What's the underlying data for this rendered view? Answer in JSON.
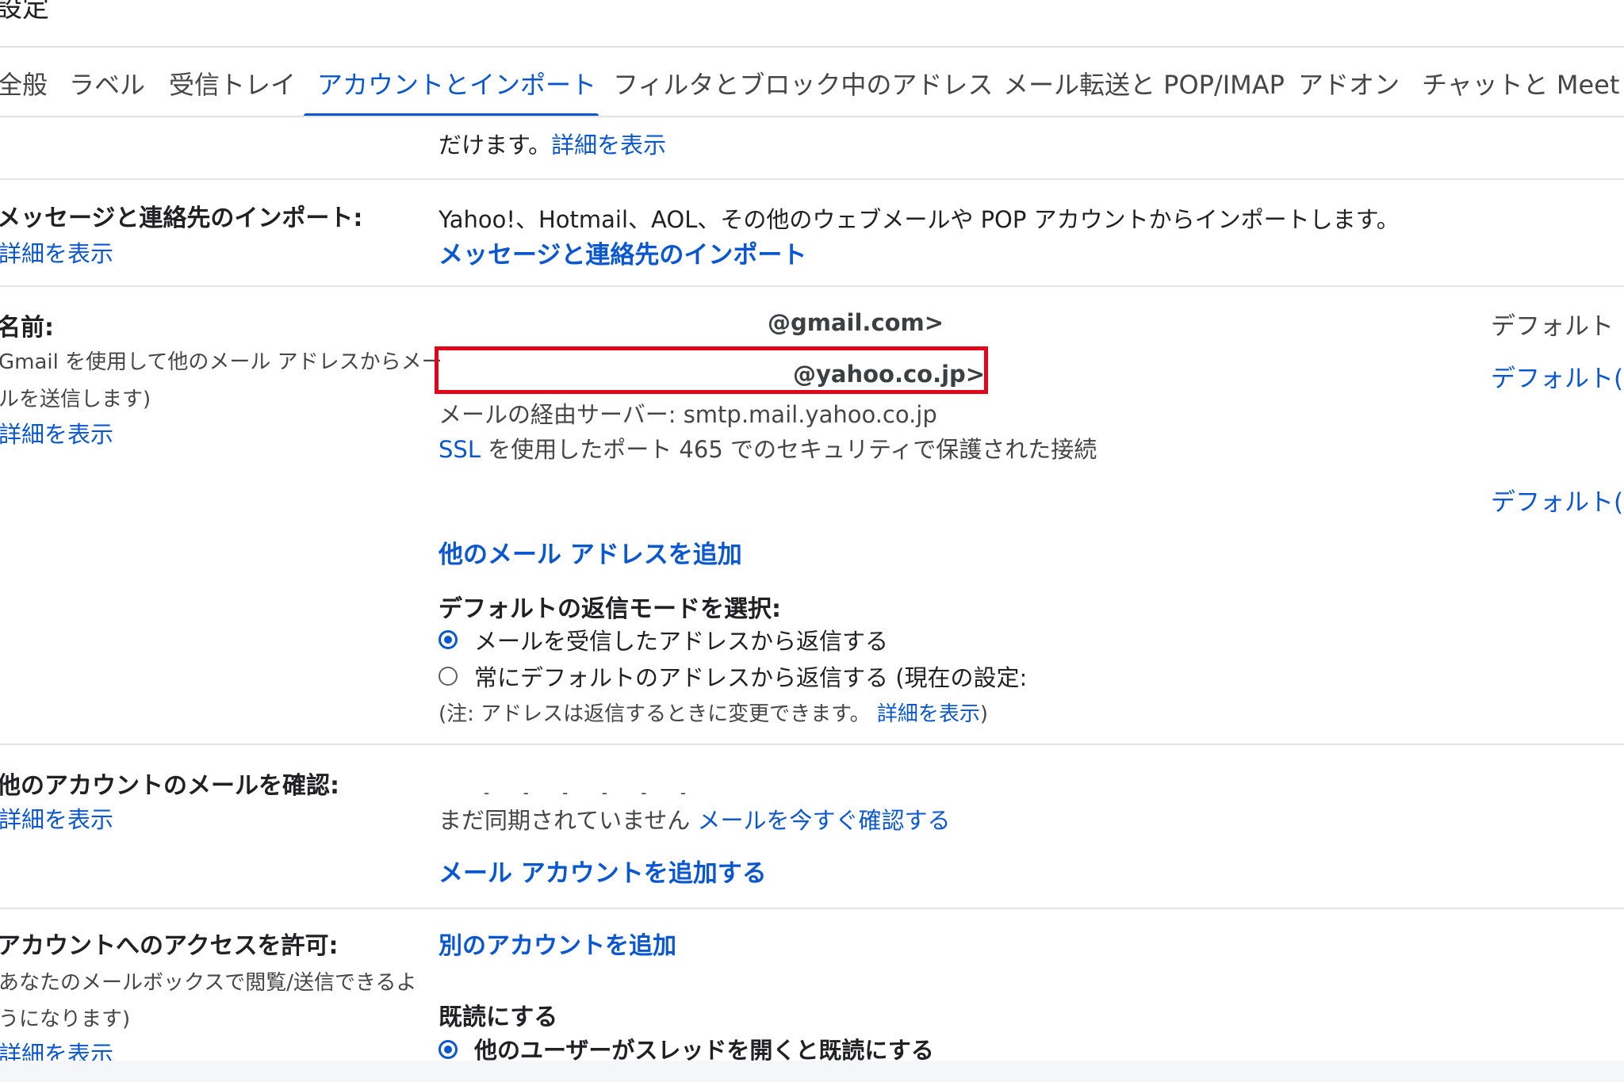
{
  "header": {
    "title": "設定"
  },
  "tabs": [
    {
      "label": "全般"
    },
    {
      "label": "ラベル"
    },
    {
      "label": "受信トレイ"
    },
    {
      "label": "アカウントとインポート"
    },
    {
      "label": "フィルタとブロック中のアドレス"
    },
    {
      "label": "メール転送と POP/IMAP"
    },
    {
      "label": "アドオン"
    },
    {
      "label": "チャットと Meet"
    }
  ],
  "top_section": {
    "text": "だけます。",
    "link": "詳細を表示"
  },
  "import_section": {
    "label": "メッセージと連絡先のインポート:",
    "learn_more": "詳細を表示",
    "description": "Yahoo!、Hotmail、AOL、その他のウェブメールや POP アカウントからインポートします。",
    "action_link": "メッセージと連絡先のインポート"
  },
  "name_section": {
    "label": "名前:",
    "desc_line1": "Gmail を使用して他のメール アドレスからメー",
    "desc_line2": "ルを送信します)",
    "learn_more": "詳細を表示",
    "address1": "@gmail.com>",
    "address2": "@yahoo.co.jp>",
    "smtp_line": "メールの経由サーバー: smtp.mail.yahoo.co.jp",
    "ssl_link": "SSL",
    "ssl_text": " を使用したポート 465 でのセキュリティで保護された接続",
    "default_label": "デフォルト",
    "make_default_1": "デフォルト(",
    "make_default_2": "デフォルト(",
    "add_address_link": "他のメール アドレスを追加",
    "reply_mode_label": "デフォルトの返信モードを選択:",
    "reply_option1": "メールを受信したアドレスから返信する",
    "reply_option2": "常にデフォルトのアドレスから返信する (現在の設定: ",
    "note_prefix": "(注: アドレスは返信するときに変更できます。 ",
    "note_link": "詳細を表示",
    "note_suffix": ")"
  },
  "check_mail_section": {
    "label": "他のアカウントのメールを確認:",
    "learn_more": "詳細を表示",
    "status": "まだ同期されていません",
    "check_now_link": "メールを今すぐ確認する",
    "add_account_link": "メール アカウントを追加する"
  },
  "grant_access_section": {
    "label": "アカウントへのアクセスを許可:",
    "desc_line1": "あなたのメールボックスで閲覧/送信できるよ",
    "desc_line2": "うになります)",
    "learn_more": "詳細を表示",
    "add_other_link": "別のアカウントを追加",
    "mark_read_label": "既読にする",
    "mark_read_option1": "他のユーザーがスレッドを開くと既読にする"
  },
  "colors": {
    "accent": "#0b57d0",
    "highlight": "#e1061c",
    "text": "#202124",
    "divider": "#e3e3e3"
  }
}
